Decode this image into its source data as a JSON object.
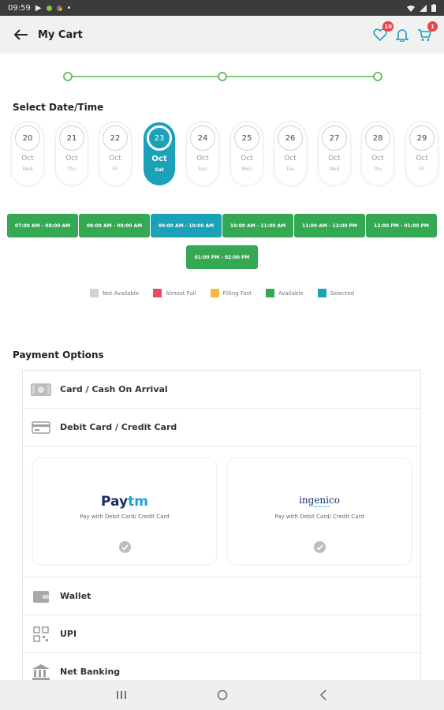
{
  "status_bar": {
    "time": "09:59"
  },
  "app_bar": {
    "title": "My Cart",
    "wishlist_badge": "10",
    "cart_badge": "1"
  },
  "steps": [
    {
      "state": "done"
    },
    {
      "state": "done"
    },
    {
      "state": "done"
    }
  ],
  "schedule": {
    "title": "Select Date/Time",
    "dates": [
      {
        "num": "20",
        "month": "Oct",
        "day": "Wed",
        "selected": false
      },
      {
        "num": "21",
        "month": "Oct",
        "day": "Thu",
        "selected": false
      },
      {
        "num": "22",
        "month": "Oct",
        "day": "Fri",
        "selected": false
      },
      {
        "num": "23",
        "month": "Oct",
        "day": "Sat",
        "selected": true
      },
      {
        "num": "24",
        "month": "Oct",
        "day": "Sun",
        "selected": false
      },
      {
        "num": "25",
        "month": "Oct",
        "day": "Mon",
        "selected": false
      },
      {
        "num": "26",
        "month": "Oct",
        "day": "Tue",
        "selected": false
      },
      {
        "num": "27",
        "month": "Oct",
        "day": "Wed",
        "selected": false
      },
      {
        "num": "28",
        "month": "Oct",
        "day": "Thu",
        "selected": false
      },
      {
        "num": "29",
        "month": "Oct",
        "day": "Fri",
        "selected": false
      }
    ],
    "slots": [
      {
        "label": "07:00 AM - 08:00 AM",
        "status": "available"
      },
      {
        "label": "08:00 AM - 09:00 AM",
        "status": "available"
      },
      {
        "label": "09:00 AM - 10:00 AM",
        "status": "selected"
      },
      {
        "label": "10:00 AM - 11:00 AM",
        "status": "available"
      },
      {
        "label": "11:00 AM - 12:00 PM",
        "status": "available"
      },
      {
        "label": "12:00 PM - 01:00 PM",
        "status": "available"
      },
      {
        "label": "01:00 PM - 02:00 PM",
        "status": "available"
      }
    ],
    "legend": [
      {
        "label": "Not Available",
        "color": "#d3d3d3"
      },
      {
        "label": "Almost Full",
        "color": "#e84a5f"
      },
      {
        "label": "Filling Fast",
        "color": "#f5b942"
      },
      {
        "label": "Available",
        "color": "#35a853"
      },
      {
        "label": "Selected",
        "color": "#1ba1b8"
      }
    ]
  },
  "payment": {
    "title": "Payment Options",
    "card_cash": "Card / Cash On Arrival",
    "debit_credit": "Debit Card / Credit Card",
    "paytm": {
      "logo_a": "Pay",
      "logo_b": "tm",
      "desc": "Pay with Debit Card/ Credit Card"
    },
    "ingenico": {
      "logo": "ingenico",
      "logo_sub": "ePayments",
      "desc": "Pay with Debit Card/ Credit Card"
    },
    "wallet": "Wallet",
    "upi": "UPI",
    "net_banking": "Net Banking"
  }
}
